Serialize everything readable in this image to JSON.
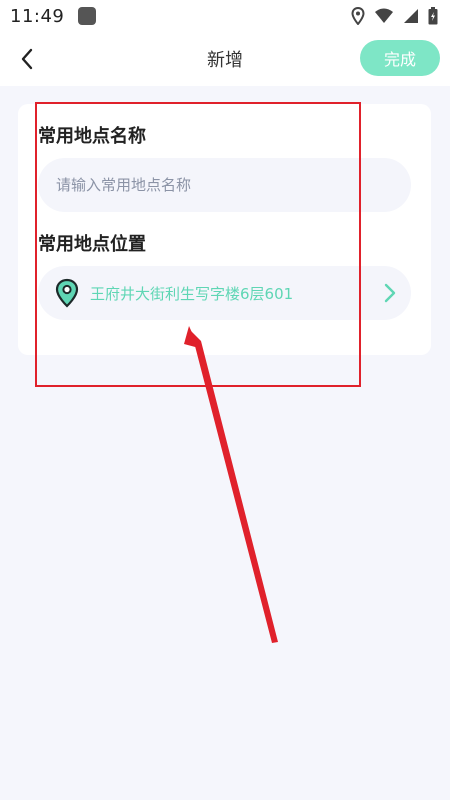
{
  "status_bar": {
    "time": "11:49",
    "icons": [
      "app-notification-icon",
      "location-icon",
      "wifi-icon",
      "signal-icon",
      "battery-icon"
    ]
  },
  "header": {
    "title": "新增",
    "done_label": "完成",
    "back_icon": "chevron-left-icon"
  },
  "form": {
    "name_label": "常用地点名称",
    "name_placeholder": "请输入常用地点名称",
    "name_value": "",
    "location_label": "常用地点位置",
    "location_value": "王府井大街利生写字楼6层601"
  },
  "colors": {
    "accent": "#5fd6b4",
    "done_button": "#7ee6c6",
    "background": "#f5f6fc",
    "annotation": "#e0212b"
  }
}
